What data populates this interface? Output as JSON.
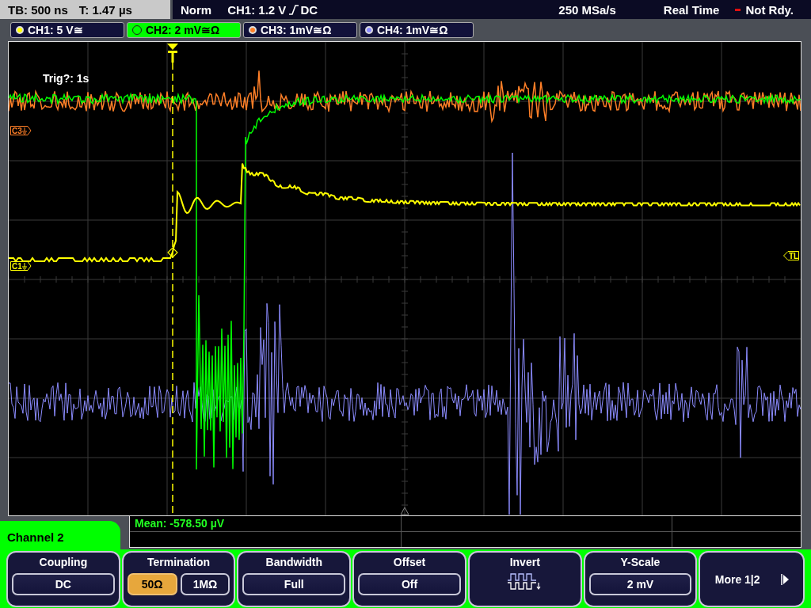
{
  "status_bar": {
    "timebase": "TB: 500 ns",
    "trigger_time": "T: 1.47 µs",
    "trigger_mode": "Norm",
    "trigger": "CH1: 1.2 V",
    "trigger_coupling": "DC",
    "sample_rate": "250 MSa/s",
    "acquisition": "Real Time",
    "status": "Not Rdy."
  },
  "channels": [
    {
      "label": "CH1: 5 V≅",
      "color": "#ffff00",
      "selected": false
    },
    {
      "label": "CH2: 2 mV≅Ω",
      "color": "#00ff00",
      "selected": true
    },
    {
      "label": "CH3: 1mV≅Ω",
      "color": "#ff7f27",
      "selected": false
    },
    {
      "label": "CH4: 1mV≅Ω",
      "color": "#8c8cff",
      "selected": false
    }
  ],
  "scope": {
    "trigger_status": "Trig?: 1s",
    "markers": [
      {
        "label": "C3",
        "color": "#ff7f27",
        "kind": "ground"
      },
      {
        "label": "C1",
        "color": "#ffff00",
        "kind": "ground"
      },
      {
        "label": "TL",
        "color": "#ffff00",
        "kind": "level"
      }
    ]
  },
  "measurement": {
    "text": "Mean: -578.50 µV"
  },
  "menu": {
    "title": "Channel 2",
    "softkeys": [
      {
        "kind": "value",
        "label": "Coupling",
        "value": "DC"
      },
      {
        "kind": "choice",
        "label": "Termination",
        "options": [
          {
            "label": "50Ω",
            "selected": true
          },
          {
            "label": "1MΩ",
            "selected": false
          }
        ]
      },
      {
        "kind": "value",
        "label": "Bandwidth",
        "value": "Full"
      },
      {
        "kind": "value",
        "label": "Offset",
        "value": "Off"
      },
      {
        "kind": "icon",
        "label": "Invert"
      },
      {
        "kind": "value",
        "label": "Y-Scale",
        "value": "2 mV"
      },
      {
        "kind": "next",
        "label": "More 1|2"
      }
    ]
  }
}
